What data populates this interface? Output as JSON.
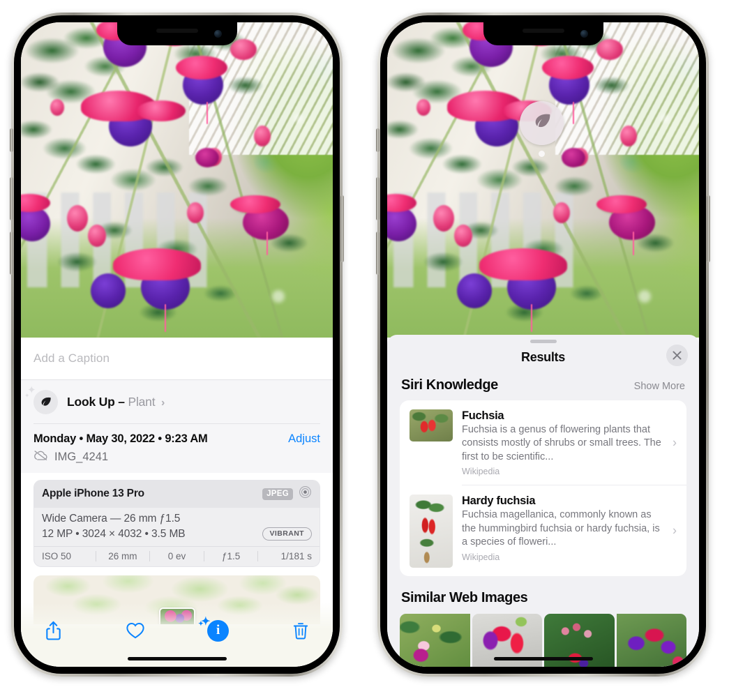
{
  "left_phone": {
    "caption_placeholder": "Add a Caption",
    "lookup": {
      "icon": "leaf-icon",
      "label": "Look Up",
      "dash": "–",
      "subject": "Plant",
      "chevron": "›"
    },
    "meta": {
      "date": "Monday • May 30, 2022 • 9:23 AM",
      "adjust_label": "Adjust",
      "filename": "IMG_4241",
      "cloud_icon": "icloud-slash-icon"
    },
    "camera_card": {
      "model": "Apple iPhone 13 Pro",
      "format_tag": "JPEG",
      "aperture_icon": "aperture-icon",
      "lens": "Wide Camera — 26 mm ƒ1.5",
      "size_line": "12 MP • 3024 × 4032 • 3.5 MB",
      "style_tag": "VIBRANT",
      "exif": [
        "ISO 50",
        "26 mm",
        "0 ev",
        "ƒ1.5",
        "1/181 s"
      ]
    },
    "toolbar": {
      "share_label": "share-icon",
      "favorite_label": "heart-icon",
      "info_label": "info-icon",
      "delete_label": "trash-icon"
    }
  },
  "right_phone": {
    "lookup_bubble_icon": "leaf-icon",
    "sheet": {
      "title": "Results",
      "close_label": "✕"
    },
    "siri_knowledge": {
      "section_title": "Siri Knowledge",
      "show_more": "Show More",
      "items": [
        {
          "title": "Fuchsia",
          "description": "Fuchsia is a genus of flowering plants that consists mostly of shrubs or small trees. The first to be scientific...",
          "source": "Wikipedia",
          "chevron": "›"
        },
        {
          "title": "Hardy fuchsia",
          "description": "Fuchsia magellanica, commonly known as the hummingbird fuchsia or hardy fuchsia, is a species of floweri...",
          "source": "Wikipedia",
          "chevron": "›"
        }
      ]
    },
    "similar_web_images": {
      "section_title": "Similar Web Images",
      "tiles": [
        "fuchsia-thumb-1",
        "fuchsia-thumb-2",
        "fuchsia-thumb-3",
        "fuchsia-thumb-4"
      ]
    }
  },
  "colors": {
    "accent_blue": "#0A84FF",
    "sheet_grey": "#F1F1F4",
    "card_white": "#FFFFFF",
    "secondary_text": "#77777E"
  }
}
